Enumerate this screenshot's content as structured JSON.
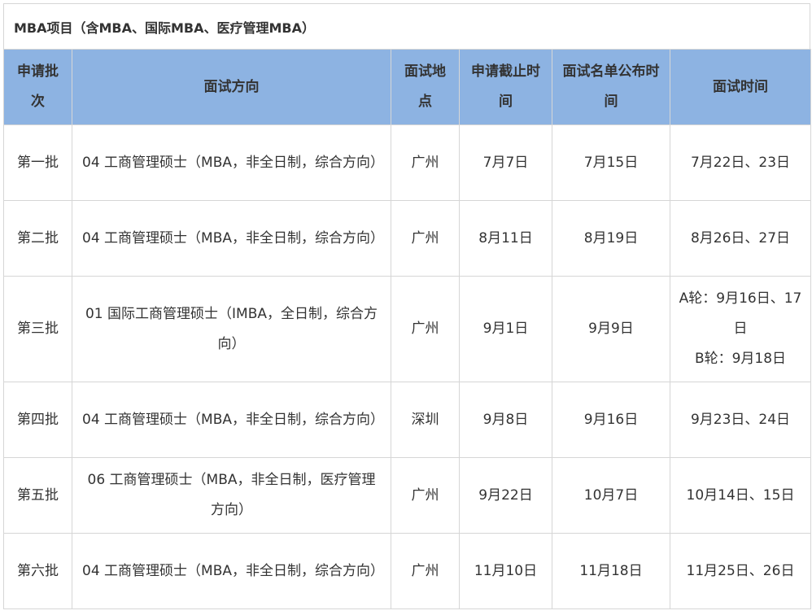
{
  "title": "MBA项目（含MBA、国际MBA、医疗管理MBA）",
  "headers": {
    "batch": "申请批次",
    "direction": "面试方向",
    "location": "面试地点",
    "deadline": "申请截止时间",
    "list_publish": "面试名单公布时间",
    "interview_time": "面试时间"
  },
  "rows": [
    {
      "batch": "第一批",
      "direction": "04 工商管理硕士（MBA，非全日制，综合方向）",
      "location": "广州",
      "deadline": "7月7日",
      "list_publish": "7月15日",
      "interview_time": "7月22日、23日"
    },
    {
      "batch": "第二批",
      "direction": "04 工商管理硕士（MBA，非全日制，综合方向）",
      "location": "广州",
      "deadline": "8月11日",
      "list_publish": "8月19日",
      "interview_time": "8月26日、27日"
    },
    {
      "batch": "第三批",
      "direction": "01 国际工商管理硕士（IMBA，全日制，综合方向）",
      "location": "广州",
      "deadline": "9月1日",
      "list_publish": "9月9日",
      "interview_time_a": "A轮：9月16日、17日",
      "interview_time_b": "B轮：9月18日"
    },
    {
      "batch": "第四批",
      "direction": "04 工商管理硕士（MBA，非全日制，综合方向）",
      "location": "深圳",
      "deadline": "9月8日",
      "list_publish": "9月16日",
      "interview_time": "9月23日、24日"
    },
    {
      "batch": "第五批",
      "direction": "06 工商管理硕士（MBA，非全日制，医疗管理方向）",
      "location": "广州",
      "deadline": "9月22日",
      "list_publish": "10月7日",
      "interview_time": "10月14日、15日"
    },
    {
      "batch": "第六批",
      "direction": "04 工商管理硕士（MBA，非全日制，综合方向）",
      "location": "广州",
      "deadline": "11月10日",
      "list_publish": "11月18日",
      "interview_time": "11月25日、26日"
    }
  ],
  "colors": {
    "header_bg": "#8db3e2",
    "border": "#d6d6d6",
    "text": "#333333"
  }
}
